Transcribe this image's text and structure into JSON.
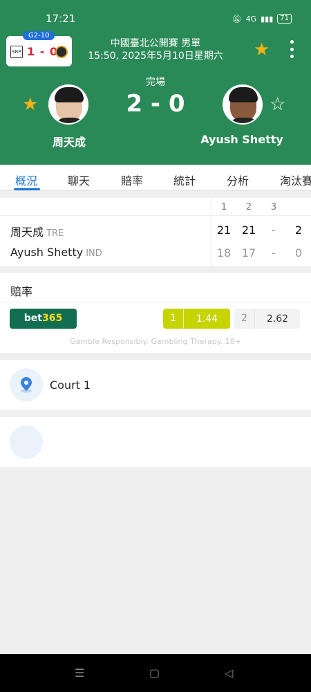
{
  "status_bar": {
    "time": "17:21",
    "battery": "71",
    "signal_text": "4G"
  },
  "mini_card": {
    "badge": "G2-10",
    "score": "1 - 0",
    "left_logo_text": "SRP"
  },
  "header": {
    "tournament": "中國臺北公開賽 男單",
    "datetime": "15:50, 2025年5月10日星期六",
    "status": "完場",
    "score": "2 - 0",
    "player_left": {
      "name": "周天成",
      "favorite": true
    },
    "player_right": {
      "name": "Ayush Shetty",
      "favorite": false
    }
  },
  "tabs": [
    "概況",
    "聊天",
    "賠率",
    "統計",
    "分析",
    "淘汰賽"
  ],
  "active_tab": "概況",
  "scoreboard": {
    "set_headers": [
      "1",
      "2",
      "3"
    ],
    "rows": [
      {
        "name": "周天成",
        "country": "TRE",
        "sets": [
          "21",
          "21",
          "-"
        ],
        "total": "2",
        "winner": true
      },
      {
        "name": "Ayush Shetty",
        "country": "IND",
        "sets": [
          "18",
          "17",
          "-"
        ],
        "total": "0",
        "winner": false
      }
    ]
  },
  "odds": {
    "title": "賠率",
    "bookmaker": {
      "part1": "bet",
      "part2": "365"
    },
    "home": {
      "label": "1",
      "value": "1.44"
    },
    "away": {
      "label": "2",
      "value": "2.62"
    },
    "disclaimer": "Gamble Responsibly. Gambling Therapy. 18+"
  },
  "venue": {
    "label": "Court 1"
  },
  "colors": {
    "header_green": "#2a8a57",
    "accent_blue": "#1e78d7",
    "star": "#f5b316",
    "odd_win": "#c6d400",
    "bet365_green": "#126e51"
  }
}
